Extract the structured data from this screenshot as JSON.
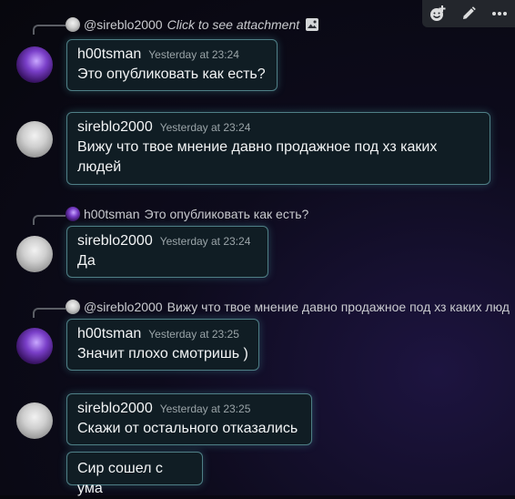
{
  "toolbar": {
    "add_reaction_icon": "emoji-plus",
    "edit_icon": "pencil",
    "more_icon": "ellipsis"
  },
  "reply1": {
    "name": "@sireblo2000",
    "text": "Click to see attachment",
    "attachment_icon": "image"
  },
  "msg1": {
    "author": "h00tsman",
    "time": "Yesterday at 23:24",
    "text": "Это опубликовать как есть?"
  },
  "msg2": {
    "author": "sireblo2000",
    "time": "Yesterday at 23:24",
    "text": "Вижу что твое мнение давно продажное под хз каких людей"
  },
  "reply2": {
    "name": "h00tsman",
    "text": "Это опубликовать как есть?"
  },
  "msg3": {
    "author": "sireblo2000",
    "time": "Yesterday at 23:24",
    "text": "Да"
  },
  "reply3": {
    "name": "@sireblo2000",
    "text": "Вижу что твое мнение давно продажное под хз каких люд"
  },
  "msg4": {
    "author": "h00tsman",
    "time": "Yesterday at 23:25",
    "text": "Значит плохо смотришь )"
  },
  "msg5": {
    "author": "sireblo2000",
    "time": "Yesterday at 23:25",
    "text": "Скажи от остального отказались"
  },
  "msg6": {
    "text": "Сир сошел с ума"
  },
  "colors": {
    "bubble_bg": "#101d24",
    "bubble_border": "#4f7f86",
    "glow": "#5ac8cd"
  }
}
